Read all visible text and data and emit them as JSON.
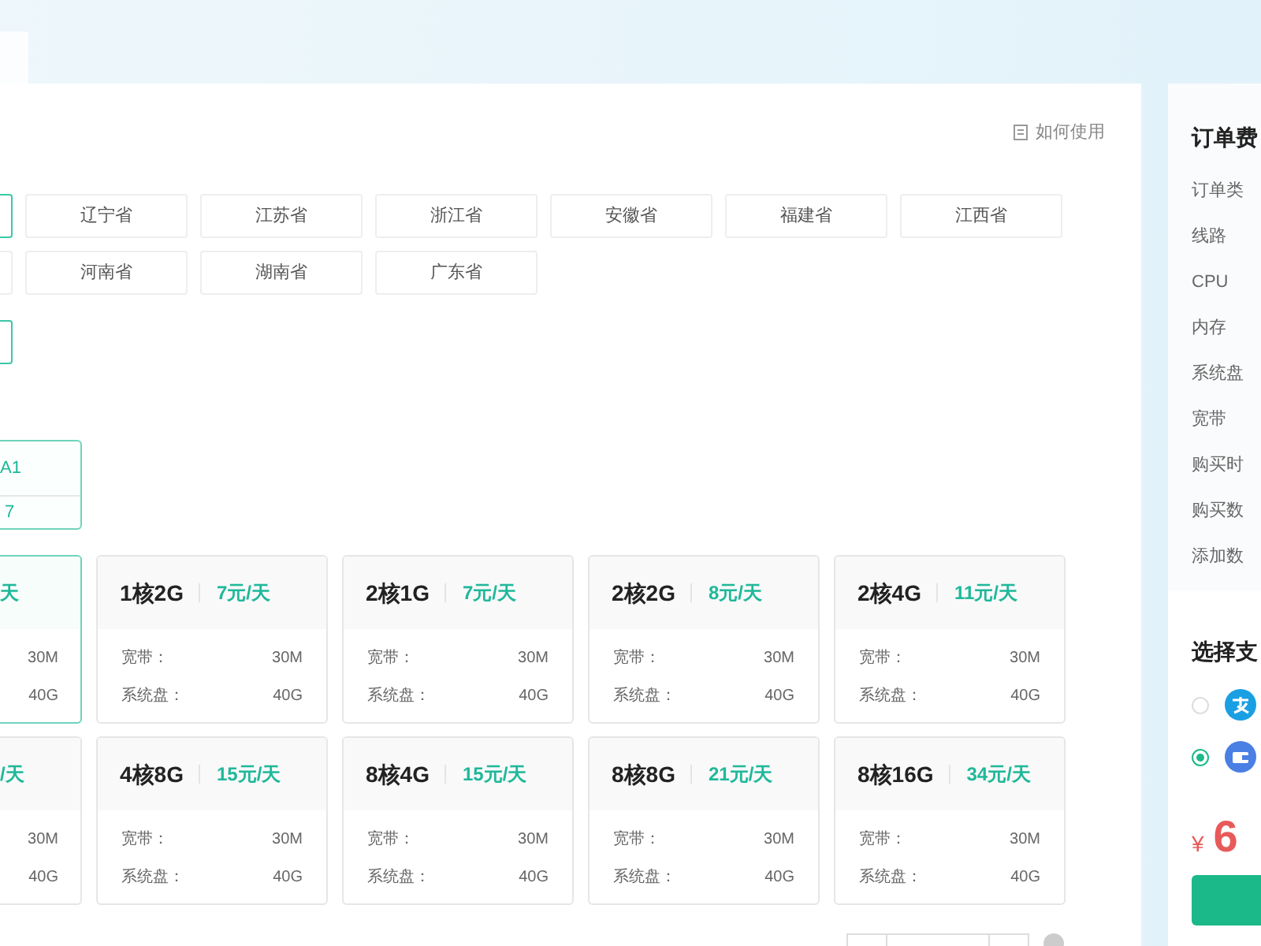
{
  "help_link": {
    "label": "如何使用"
  },
  "province_rows": [
    [
      {
        "selected": true
      },
      {
        "label": "辽宁省",
        "selected": false
      },
      {
        "label": "江苏省",
        "selected": false
      },
      {
        "label": "浙江省",
        "selected": false
      },
      {
        "label": "安徽省",
        "selected": false
      },
      {
        "label": "福建省",
        "selected": false
      },
      {
        "label": "江西省",
        "selected": false
      }
    ],
    [
      {
        "selected": false
      },
      {
        "label": "河南省",
        "selected": false
      },
      {
        "label": "湖南省",
        "selected": false
      },
      {
        "label": "广东省",
        "selected": false
      }
    ]
  ],
  "option_group": [
    {
      "selected": true
    }
  ],
  "line": {
    "name": "A1",
    "value": "7",
    "selected": true
  },
  "plans": [
    {
      "price": "天",
      "bandwidth": "30M",
      "disk": "40G",
      "selected": true
    },
    {
      "name": "1核2G",
      "price": "7元/天",
      "bandwidth_label": "宽带：",
      "bandwidth": "30M",
      "disk_label": "系统盘：",
      "disk": "40G",
      "selected": false
    },
    {
      "name": "2核1G",
      "price": "7元/天",
      "bandwidth_label": "宽带：",
      "bandwidth": "30M",
      "disk_label": "系统盘：",
      "disk": "40G",
      "selected": false
    },
    {
      "name": "2核2G",
      "price": "8元/天",
      "bandwidth_label": "宽带：",
      "bandwidth": "30M",
      "disk_label": "系统盘：",
      "disk": "40G",
      "selected": false
    },
    {
      "name": "2核4G",
      "price": "11元/天",
      "bandwidth_label": "宽带：",
      "bandwidth": "30M",
      "disk_label": "系统盘：",
      "disk": "40G",
      "selected": false
    },
    {
      "price": "/天",
      "bandwidth": "30M",
      "disk": "40G",
      "selected": false
    },
    {
      "name": "4核8G",
      "price": "15元/天",
      "bandwidth_label": "宽带：",
      "bandwidth": "30M",
      "disk_label": "系统盘：",
      "disk": "40G",
      "selected": false
    },
    {
      "name": "8核4G",
      "price": "15元/天",
      "bandwidth_label": "宽带：",
      "bandwidth": "30M",
      "disk_label": "系统盘：",
      "disk": "40G",
      "selected": false
    },
    {
      "name": "8核8G",
      "price": "21元/天",
      "bandwidth_label": "宽带：",
      "bandwidth": "30M",
      "disk_label": "系统盘：",
      "disk": "40G",
      "selected": false
    },
    {
      "name": "8核16G",
      "price": "34元/天",
      "bandwidth_label": "宽带：",
      "bandwidth": "30M",
      "disk_label": "系统盘：",
      "disk": "40G",
      "selected": false
    }
  ],
  "summary": {
    "title": "订单费",
    "items": [
      "订单类",
      "线路",
      "CPU",
      "内存",
      "系统盘",
      "宽带",
      "购买时",
      "购买数",
      "添加数"
    ]
  },
  "payment": {
    "title": "选择支",
    "methods": [
      {
        "kind": "alipay",
        "selected": false
      },
      {
        "kind": "wallet",
        "selected": true
      }
    ]
  },
  "total": {
    "currency": "¥",
    "amount": "6"
  }
}
